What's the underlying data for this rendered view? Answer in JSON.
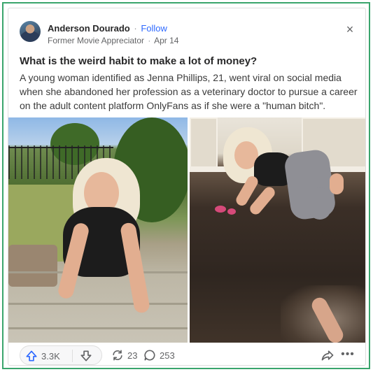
{
  "post": {
    "author": {
      "name": "Anderson Dourado",
      "follow_label": "Follow",
      "separator": "·",
      "credential": "Former Movie Appreciator",
      "date": "Apr 14"
    },
    "close_label": "×",
    "question": "What is the weird habit to make a lot of money?",
    "body": "A young woman identified as Jenna Phillips, 21, went viral on social media when she abandoned her profession as a veterinary doctor to pursue a career on the adult content platform OnlyFans as if she were a \"human bitch\".",
    "images": [
      {
        "name": "photo-woman-on-steps"
      },
      {
        "name": "photo-woman-on-floor"
      }
    ],
    "actions": {
      "upvotes": "3.3K",
      "reshares": "23",
      "comments": "253",
      "more_label": "•••"
    }
  },
  "colors": {
    "frame_border": "#3aa56c",
    "follow_link": "#2e69ff",
    "upvote_icon": "#2e69ff",
    "muted_text": "#636466"
  },
  "icons": {
    "upvote": "upvote-arrow-icon",
    "downvote": "downvote-arrow-icon",
    "reshare": "reshare-icon",
    "comment": "comment-bubble-icon",
    "share": "share-arrow-icon",
    "close": "close-icon",
    "more": "more-dots-icon"
  }
}
